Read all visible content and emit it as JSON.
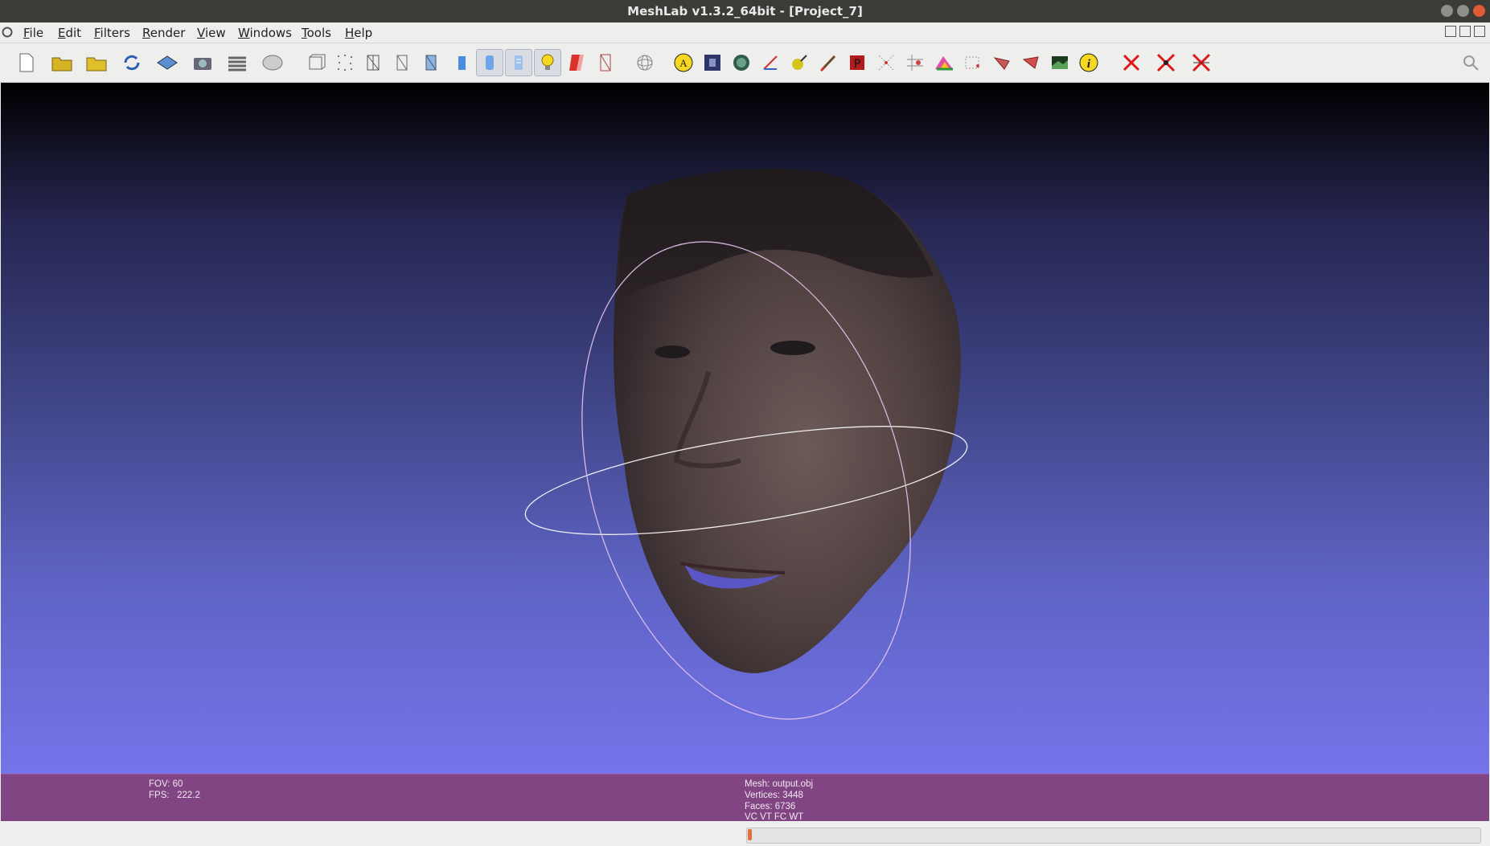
{
  "window": {
    "title": "MeshLab v1.3.2_64bit - [Project_7]"
  },
  "menu": {
    "items": [
      "File",
      "Edit",
      "Filters",
      "Render",
      "View",
      "Windows",
      "Tools",
      "Help"
    ]
  },
  "toolbar": {
    "buttons": [
      "new-project-icon",
      "open-project-icon",
      "import-mesh-icon",
      "reload-icon",
      "save-icon",
      "snapshot-icon",
      "layers-icon",
      "raster-icon",
      "bounding-box-icon",
      "points-icon",
      "wireframe-icon",
      "hidden-lines-icon",
      "flat-lines-icon",
      "flat-icon",
      "smooth-icon",
      "texture-icon",
      "light-icon",
      "double-side-lighting-icon",
      "back-face-culling-icon",
      "trackball-icon",
      "annotate-icon",
      "raster-image-icon",
      "sphere-texture-icon",
      "measure-tool-icon",
      "paint-icon",
      "brush-icon",
      "select-faces-icon",
      "select-vertices-icon",
      "select-connected-icon",
      "color-paint-icon",
      "select-region-icon",
      "align-icon",
      "manipulator-icon",
      "z-painting-icon",
      "texture-map-icon",
      "info-icon",
      "delete-faces-icon",
      "delete-vertices-icon",
      "delete-all-icon"
    ]
  },
  "info": {
    "left": {
      "fov": "FOV: 60",
      "fps": "FPS:   222.2"
    },
    "right": {
      "mesh": "Mesh: output.obj",
      "vertices": "Vertices: 3448",
      "faces": "Faces: 6736",
      "attributes": "VC VT FC WT"
    }
  },
  "status": {
    "progress_fraction": 0.005
  },
  "colors": {
    "accent": "#804582",
    "progress": "#e26f3c",
    "trackball": "#ffffff"
  }
}
